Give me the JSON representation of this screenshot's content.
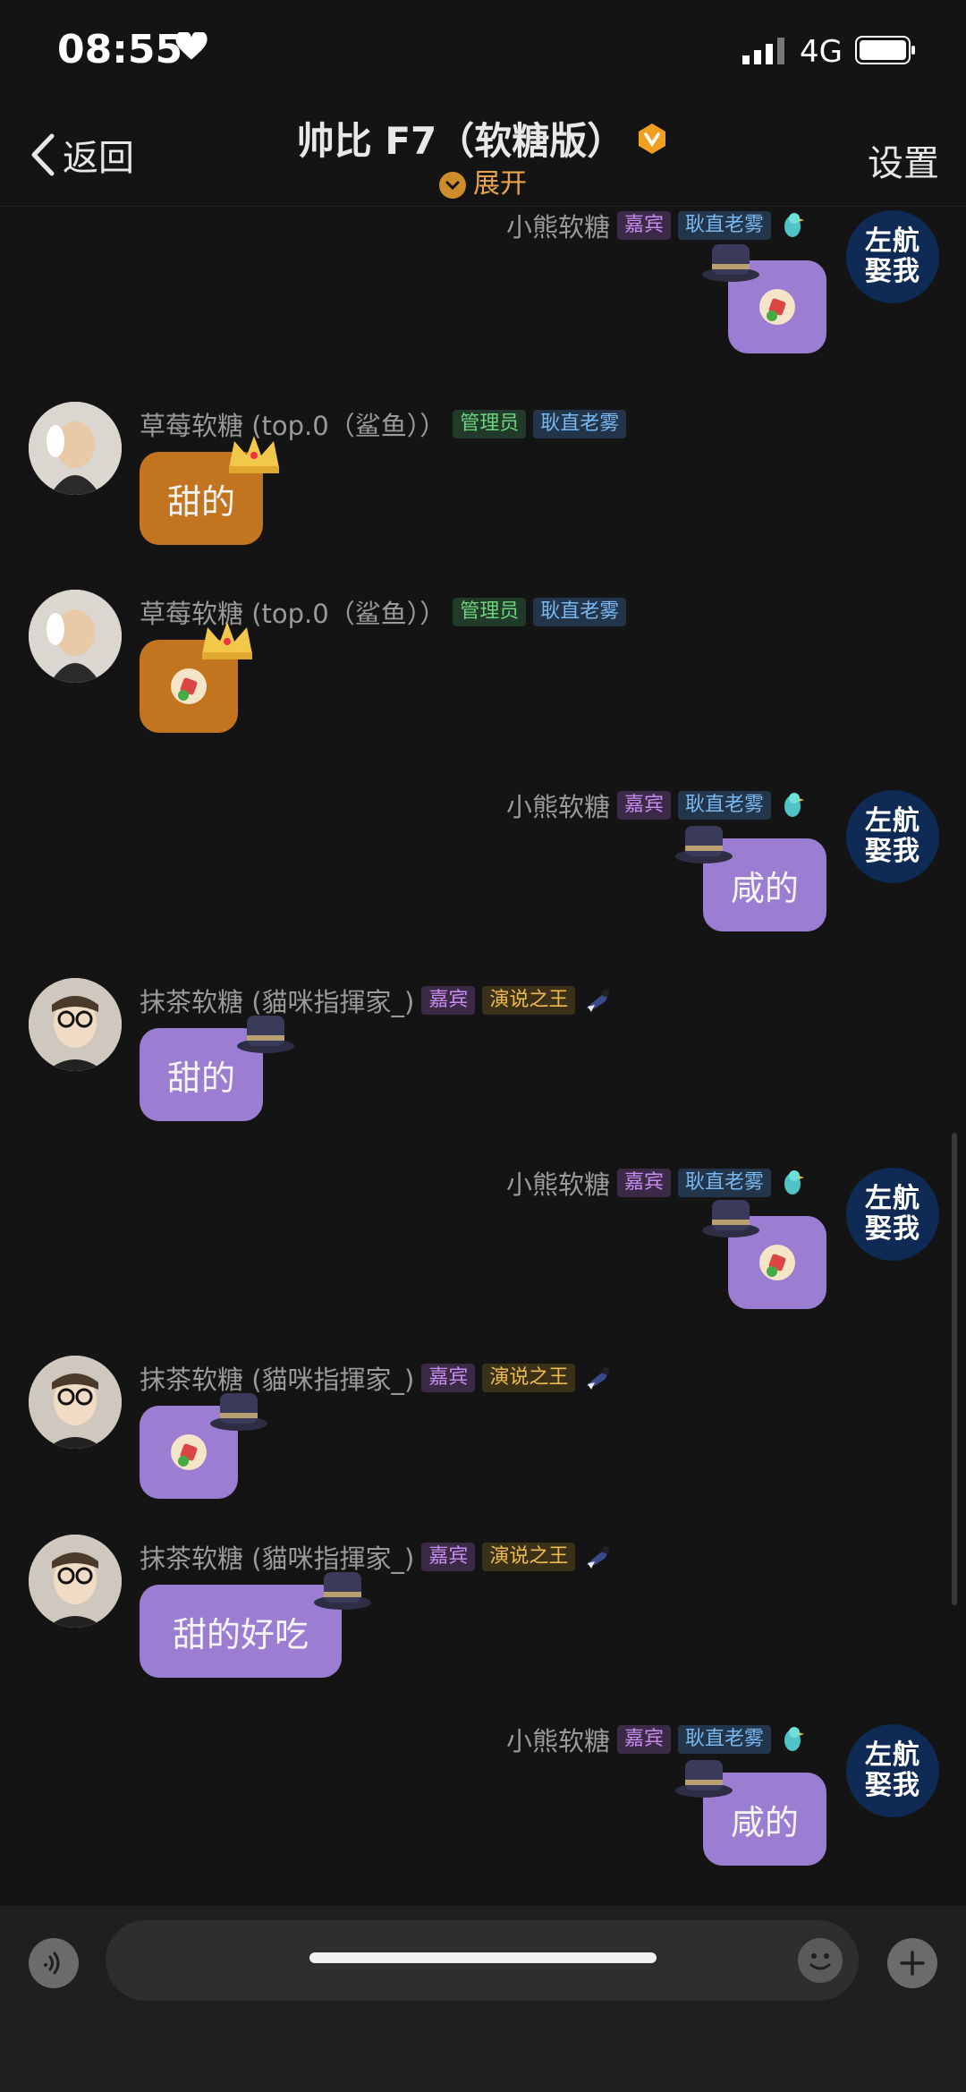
{
  "status": {
    "time": "08:55",
    "network": "4G"
  },
  "header": {
    "back_label": "返回",
    "title": "帅比 F7（软糖版）",
    "expand_label": "展开",
    "settings_label": "设置"
  },
  "composer": {
    "placeholder": ""
  },
  "messages": [
    {
      "sender": "小熊软糖",
      "side": "right",
      "badges": [
        "嘉宾",
        "耿直老雾"
      ],
      "content": "",
      "avatar_text": [
        "左航",
        "娶我"
      ]
    },
    {
      "sender": "草莓软糖 (top.0（鲨鱼））",
      "side": "left",
      "badges": [
        "管理员",
        "耿直老雾"
      ],
      "content": "甜的"
    },
    {
      "sender": "草莓软糖 (top.0（鲨鱼））",
      "side": "left",
      "badges": [
        "管理员",
        "耿直老雾"
      ],
      "content": ""
    },
    {
      "sender": "小熊软糖",
      "side": "right",
      "badges": [
        "嘉宾",
        "耿直老雾"
      ],
      "content": "咸的",
      "avatar_text": [
        "左航",
        "娶我"
      ]
    },
    {
      "sender": "抹茶软糖 (貓咪指揮家_)",
      "side": "left",
      "badges": [
        "嘉宾",
        "演说之王"
      ],
      "content": "甜的"
    },
    {
      "sender": "小熊软糖",
      "side": "right",
      "badges": [
        "嘉宾",
        "耿直老雾"
      ],
      "content": "",
      "avatar_text": [
        "左航",
        "娶我"
      ]
    },
    {
      "sender": "抹茶软糖 (貓咪指揮家_)",
      "side": "left",
      "badges": [
        "嘉宾",
        "演说之王"
      ],
      "content": ""
    },
    {
      "sender": "抹茶软糖 (貓咪指揮家_)",
      "side": "left",
      "badges": [
        "嘉宾",
        "演说之王"
      ],
      "content": "甜的好吃"
    },
    {
      "sender": "小熊软糖",
      "side": "right",
      "badges": [
        "嘉宾",
        "耿直老雾"
      ],
      "content": "咸的",
      "avatar_text": [
        "左航",
        "娶我"
      ]
    }
  ]
}
